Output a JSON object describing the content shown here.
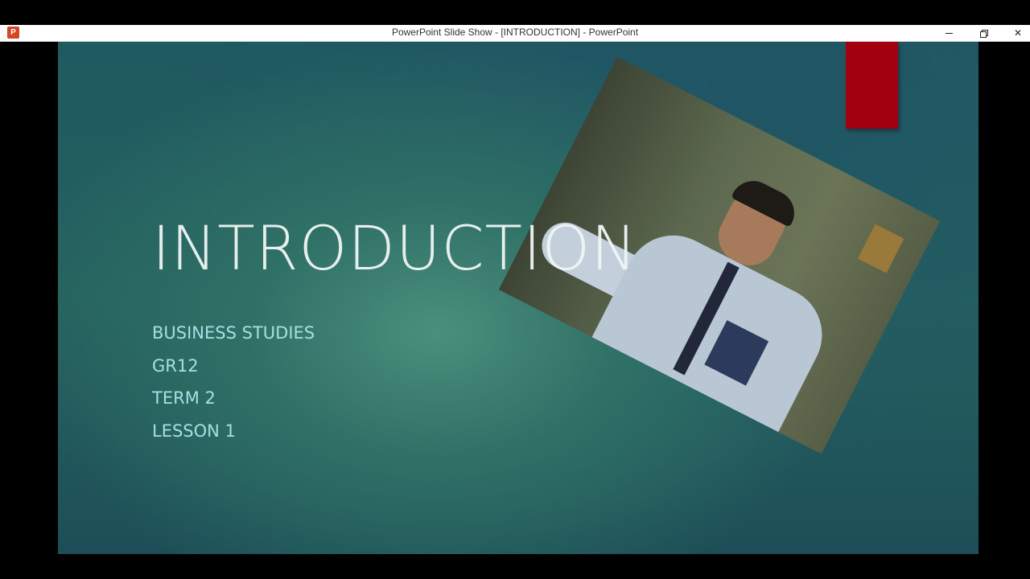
{
  "window": {
    "title": "PowerPoint Slide Show - [INTRODUCTION] - PowerPoint",
    "app_icon_letter": "P"
  },
  "slide": {
    "title": "INTRODUCTION",
    "bullets": [
      "BUSINESS STUDIES",
      "GR12",
      "TERM 2",
      "LESSON 1"
    ]
  },
  "colors": {
    "accent_red": "#a3000f",
    "subtitle_text": "#a6dfe2"
  },
  "icons": {
    "app": "powerpoint-icon",
    "minimize": "minimize-icon",
    "restore": "restore-icon",
    "close": "close-icon"
  }
}
